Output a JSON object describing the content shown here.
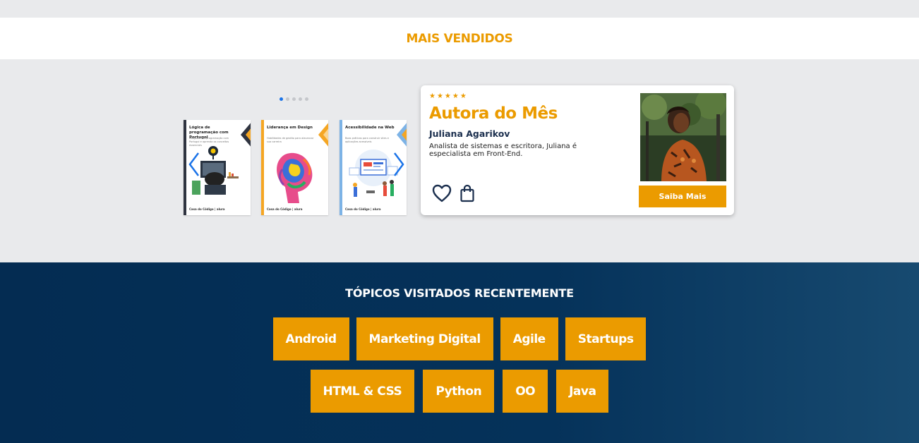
{
  "best_sellers": {
    "heading": "MAIS VENDIDOS"
  },
  "carousel": {
    "dots": 5,
    "active_dot": 0,
    "prev_icon": "chevron-left-icon",
    "next_icon": "chevron-right-icon",
    "books": [
      {
        "title": "Lógica de programação com Portugol",
        "subtitle": "Mergulhe em programação com Portugol e aprenda os conceitos essenciais",
        "logo": "Casa do Código | alura",
        "accent": "#2f3440"
      },
      {
        "title": "Liderança em Design",
        "subtitle": "Habilidades de gestão para alavancar sua carreira",
        "logo": "Casa do Código | alura",
        "accent": "#f5a623"
      },
      {
        "title": "Acessibilidade na Web",
        "subtitle": "Boas práticas para construir sites e aplicações acessíveis",
        "logo": "Casa do Código | alura",
        "accent": "#7db3e6"
      }
    ]
  },
  "author_card": {
    "stars": "★★★★★",
    "title": "Autora do Mês",
    "author": "Juliana Agarikov",
    "description": "Analista de sistemas e escritora, Juliana é especialista em Front-End.",
    "favorite_icon": "heart-icon",
    "bag_icon": "shopping-bag-icon",
    "button_label": "Saiba Mais"
  },
  "topics": {
    "title": "TÓPICOS VISITADOS RECENTEMENTE",
    "row1": [
      "Android",
      "Marketing Digital",
      "Agile",
      "Startups"
    ],
    "row2": [
      "HTML & CSS",
      "Python",
      "OO",
      "Java"
    ]
  },
  "colors": {
    "accent": "#eb9b00",
    "navy": "#042c52",
    "highlight": "#1a73e8"
  }
}
